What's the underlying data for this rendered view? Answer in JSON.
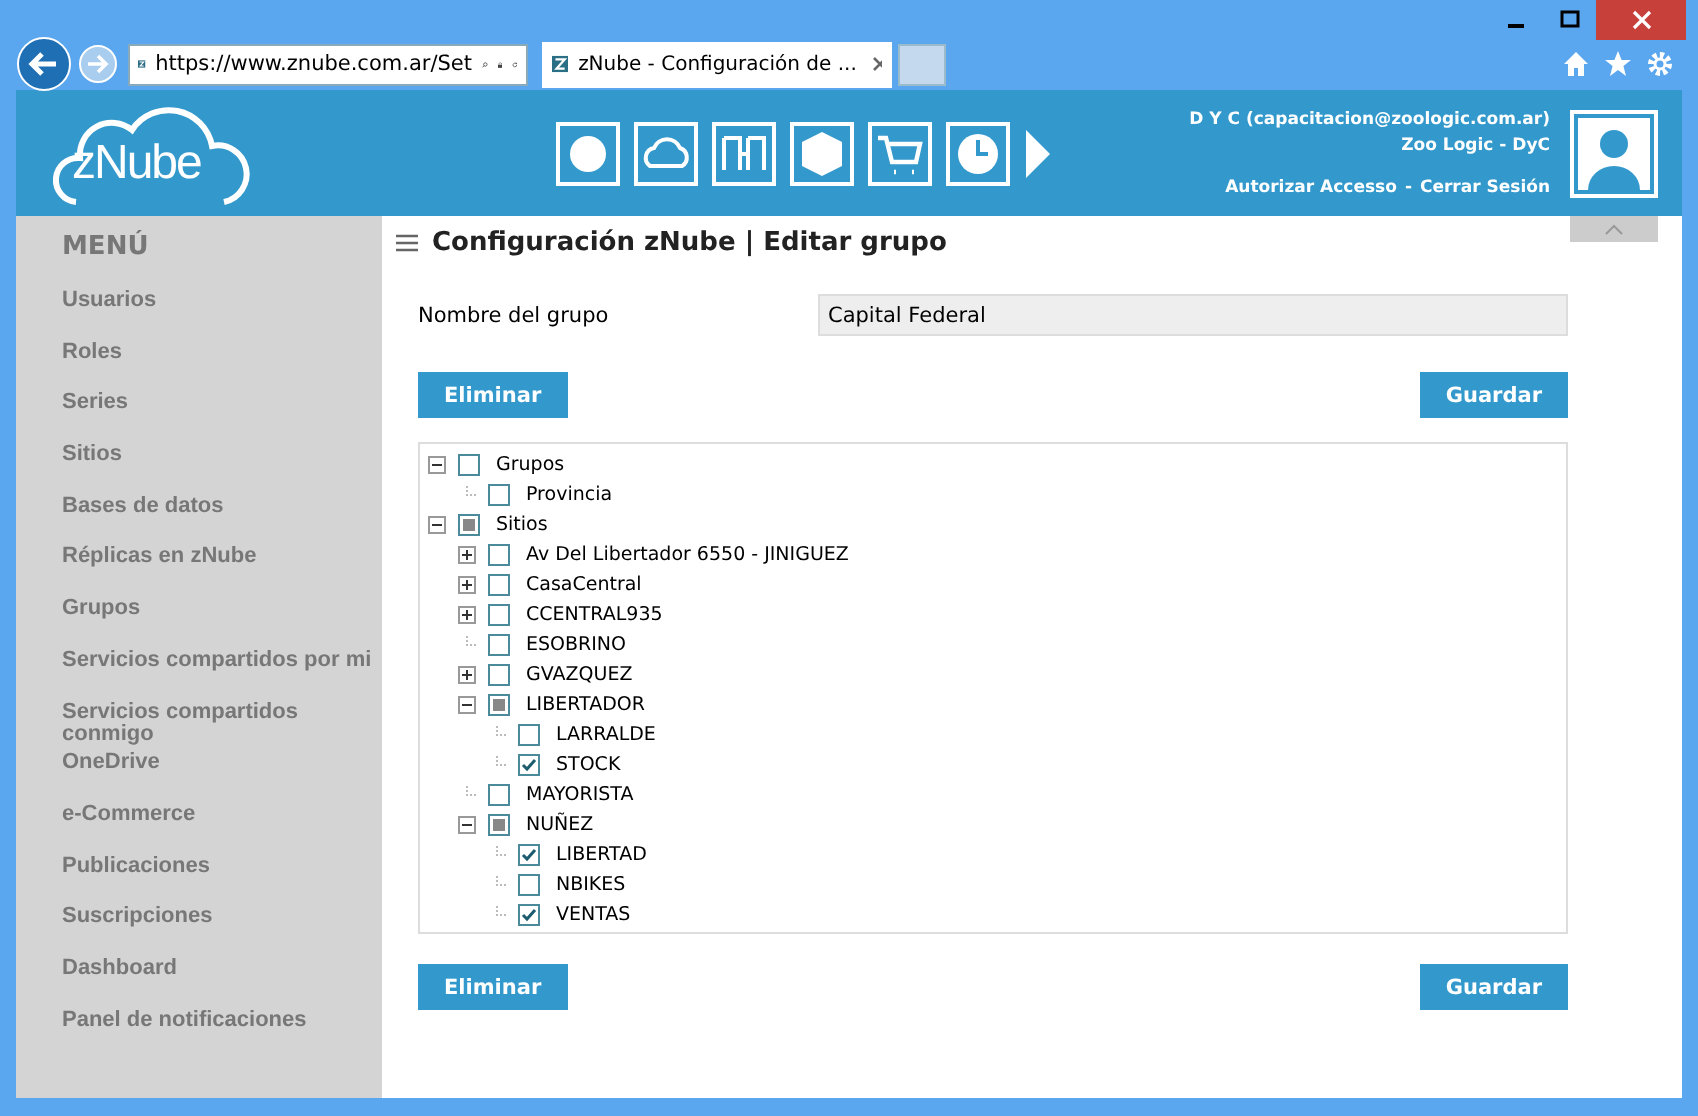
{
  "browser": {
    "address": "https://www.znube.com.ar/Set",
    "tab_title": "zNube - Configuración de ..."
  },
  "header": {
    "logo": "zNube",
    "user": "D Y C (capacitacion@zoologic.com.ar)",
    "company": "Zoo Logic - DyC",
    "links": [
      "Autorizar Accesso",
      "Cerrar Sesión"
    ],
    "link_separator": "-"
  },
  "sidebar": {
    "title": "MENÚ",
    "items": [
      "Usuarios",
      "Roles",
      "Series",
      "Sitios",
      "Bases de datos",
      "Réplicas en zNube",
      "Grupos",
      "Servicios compartidos por mi",
      "Servicios compartidos conmigo",
      "OneDrive",
      "e-Commerce",
      "Publicaciones",
      "Suscripciones",
      "Dashboard",
      "Panel de notificaciones"
    ]
  },
  "page": {
    "title": "Configuración zNube | Editar grupo",
    "field_label": "Nombre del grupo",
    "field_value": "Capital Federal",
    "delete_button": "Eliminar",
    "save_button": "Guardar",
    "tree": [
      {
        "label": "Grupos",
        "checked": false,
        "partial": false,
        "expanded": true,
        "children": [
          {
            "label": "Provincia",
            "checked": false,
            "partial": false
          }
        ]
      },
      {
        "label": "Sitios",
        "checked": false,
        "partial": true,
        "expanded": true,
        "children": [
          {
            "label": "Av Del Libertador 6550 - JINIGUEZ",
            "checked": false,
            "partial": false,
            "expanded": false
          },
          {
            "label": "CasaCentral",
            "checked": false,
            "partial": false,
            "expanded": false
          },
          {
            "label": "CCENTRAL935",
            "checked": false,
            "partial": false,
            "expanded": false
          },
          {
            "label": "ESOBRINO",
            "checked": false,
            "partial": false
          },
          {
            "label": "GVAZQUEZ",
            "checked": false,
            "partial": false,
            "expanded": false
          },
          {
            "label": "LIBERTADOR",
            "checked": false,
            "partial": true,
            "expanded": true,
            "children": [
              {
                "label": "LARRALDE",
                "checked": false,
                "partial": false
              },
              {
                "label": "STOCK",
                "checked": true,
                "partial": false
              }
            ]
          },
          {
            "label": "MAYORISTA",
            "checked": false,
            "partial": false
          },
          {
            "label": "NUÑEZ",
            "checked": false,
            "partial": true,
            "expanded": true,
            "children": [
              {
                "label": "LIBERTAD",
                "checked": true,
                "partial": false
              },
              {
                "label": "NBIKES",
                "checked": false,
                "partial": false
              },
              {
                "label": "VENTAS",
                "checked": true,
                "partial": false
              }
            ]
          }
        ]
      }
    ],
    "footer_delete_button": "Eliminar",
    "footer_save_button": "Guardar"
  }
}
